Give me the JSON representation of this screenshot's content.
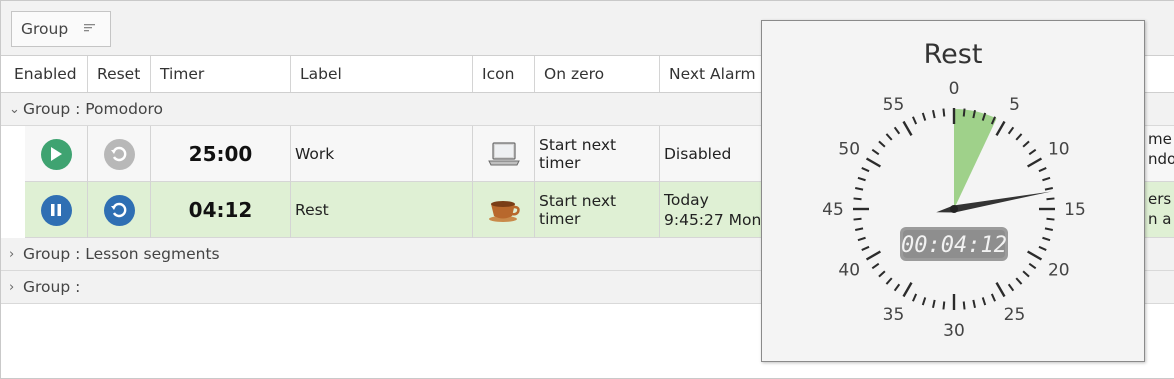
{
  "group_panel": {
    "chip_label": "Group"
  },
  "columns": {
    "enabled": "Enabled",
    "reset": "Reset",
    "timer": "Timer",
    "label": "Label",
    "icon": "Icon",
    "on_zero": "On zero",
    "next_alarm": "Next Alarm"
  },
  "groups": [
    {
      "label": "Group : Pomodoro"
    },
    {
      "label": "Group : Lesson segments"
    },
    {
      "label": "Group :"
    }
  ],
  "rows": [
    {
      "timer": "25:00",
      "label": "Work",
      "icon": "laptop-icon",
      "on_zero": "Start next timer",
      "next_alarm": "Disabled",
      "enabled_state": "play",
      "cut_line1": "me (",
      "cut_line2": "ndow"
    },
    {
      "timer": "04:12",
      "label": "Rest",
      "icon": "coffee-cup-icon",
      "on_zero": "Start next timer",
      "next_alarm_line1": "Today",
      "next_alarm_line2": "9:45:27 Mon",
      "enabled_state": "pause",
      "cut_line1": "ers v",
      "cut_line2": "n a s"
    }
  ],
  "popup": {
    "title": "Rest",
    "digital": "00:04:12",
    "dial_labels": [
      "0",
      "5",
      "10",
      "15",
      "20",
      "25",
      "30",
      "35",
      "40",
      "45",
      "50",
      "55"
    ],
    "remaining_minutes": 4.2,
    "colors": {
      "wedge": "#9fd18a",
      "hand": "#333333",
      "digital_bg": "#9b9b9b",
      "digital_fg": "#f2f2f2"
    }
  },
  "colors": {
    "play": "#3fa371",
    "pause": "#2f6fb3",
    "reset_disabled": "#b8b8b8",
    "reset_active": "#2f6fb3",
    "selected_row": "#dff0d4"
  }
}
